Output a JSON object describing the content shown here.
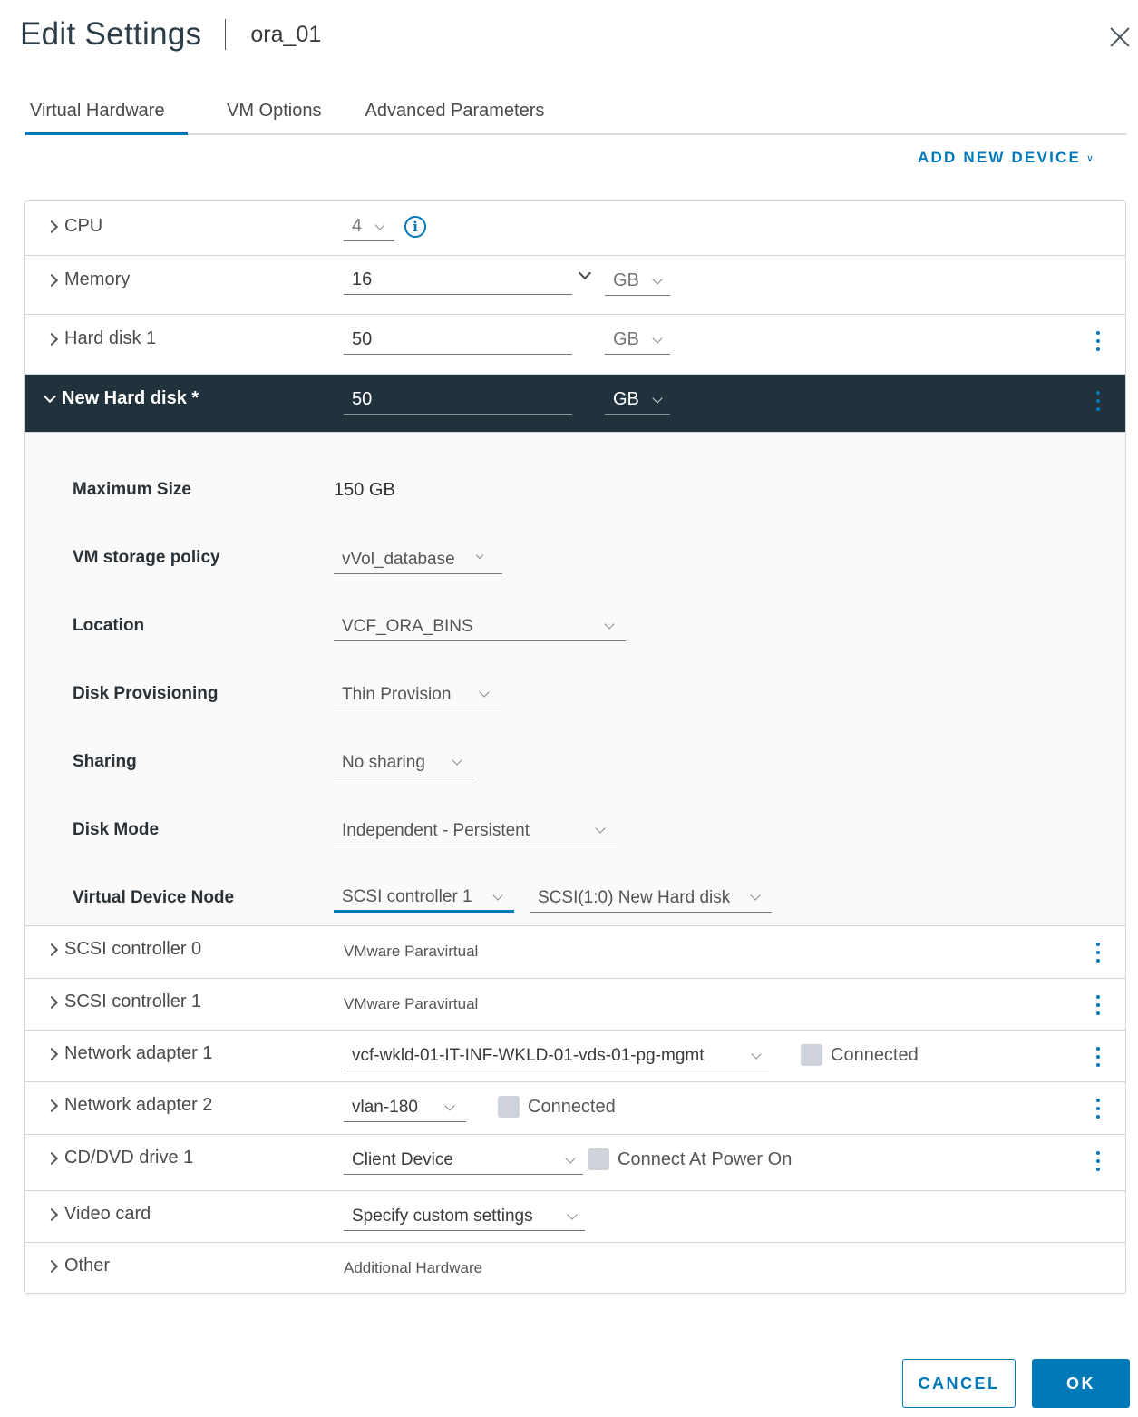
{
  "header": {
    "title": "Edit Settings",
    "vm_name": "ora_01",
    "close_icon": "close-icon"
  },
  "tabs": [
    {
      "label": "Virtual Hardware",
      "active": true
    },
    {
      "label": "VM Options",
      "active": false
    },
    {
      "label": "Advanced Parameters",
      "active": false
    }
  ],
  "add_new_device": "ADD NEW DEVICE",
  "hardware": {
    "cpu": {
      "label": "CPU",
      "value": "4"
    },
    "memory": {
      "label": "Memory",
      "value": "16",
      "unit": "GB"
    },
    "hard_disk_1": {
      "label": "Hard disk 1",
      "value": "50",
      "unit": "GB"
    },
    "new_hard_disk": {
      "label": "New Hard disk *",
      "value": "50",
      "unit": "GB",
      "details": {
        "max_size": {
          "label": "Maximum Size",
          "value": "150 GB"
        },
        "storage_policy": {
          "label": "VM storage policy",
          "value": "vVol_database"
        },
        "location": {
          "label": "Location",
          "value": "VCF_ORA_BINS"
        },
        "provisioning": {
          "label": "Disk Provisioning",
          "value": "Thin Provision"
        },
        "sharing": {
          "label": "Sharing",
          "value": "No sharing"
        },
        "disk_mode": {
          "label": "Disk Mode",
          "value": "Independent - Persistent"
        },
        "device_node": {
          "label": "Virtual Device Node",
          "controller": "SCSI controller 1",
          "node": "SCSI(1:0) New Hard disk"
        }
      }
    },
    "scsi_0": {
      "label": "SCSI controller 0",
      "value": "VMware Paravirtual"
    },
    "scsi_1": {
      "label": "SCSI controller 1",
      "value": "VMware Paravirtual"
    },
    "net_1": {
      "label": "Network adapter 1",
      "value": "vcf-wkld-01-IT-INF-WKLD-01-vds-01-pg-mgmt",
      "checkbox_label": "Connected",
      "checked": false
    },
    "net_2": {
      "label": "Network adapter 2",
      "value": "vlan-180",
      "checkbox_label": "Connected",
      "checked": false
    },
    "cd_dvd": {
      "label": "CD/DVD drive 1",
      "value": "Client Device",
      "checkbox_label": "Connect At Power On",
      "checked": false
    },
    "video": {
      "label": "Video card",
      "value": "Specify custom settings"
    },
    "other": {
      "label": "Other",
      "value": "Additional Hardware"
    }
  },
  "footer": {
    "cancel": "CANCEL",
    "ok": "OK"
  },
  "colors": {
    "accent": "#0079b8",
    "expanded_row": "#22323c"
  }
}
